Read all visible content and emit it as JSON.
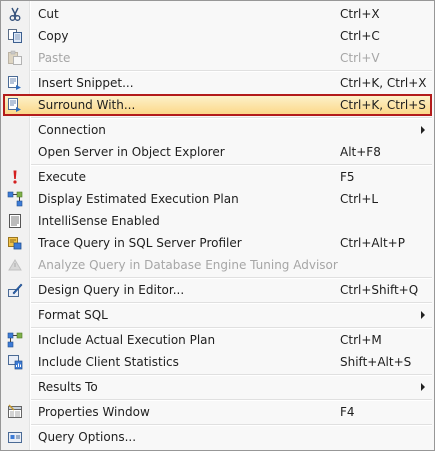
{
  "menu": {
    "items": [
      {
        "id": "cut",
        "label": "Cut",
        "shortcut": "Ctrl+X",
        "icon": "scissors-icon",
        "disabled": false
      },
      {
        "id": "copy",
        "label": "Copy",
        "shortcut": "Ctrl+C",
        "icon": "copy-icon",
        "disabled": false
      },
      {
        "id": "paste",
        "label": "Paste",
        "shortcut": "Ctrl+V",
        "icon": "paste-icon",
        "disabled": true
      },
      {
        "id": "insert-snippet",
        "label": "Insert Snippet...",
        "shortcut": "Ctrl+K, Ctrl+X",
        "icon": "snippet-icon",
        "disabled": false
      },
      {
        "id": "surround-with",
        "label": "Surround With...",
        "shortcut": "Ctrl+K, Ctrl+S",
        "icon": "surround-icon",
        "disabled": false,
        "highlighted": true
      },
      {
        "id": "connection",
        "label": "Connection",
        "shortcut": "",
        "icon": "",
        "submenu": true
      },
      {
        "id": "open-server",
        "label": "Open Server in Object Explorer",
        "shortcut": "Alt+F8",
        "icon": ""
      },
      {
        "id": "execute",
        "label": "Execute",
        "shortcut": "F5",
        "icon": "execute-icon"
      },
      {
        "id": "display-plan",
        "label": "Display Estimated Execution Plan",
        "shortcut": "Ctrl+L",
        "icon": "execution-plan-icon"
      },
      {
        "id": "intellisense",
        "label": "IntelliSense Enabled",
        "shortcut": "",
        "icon": "intellisense-icon"
      },
      {
        "id": "trace-query",
        "label": "Trace Query in SQL Server Profiler",
        "shortcut": "Ctrl+Alt+P",
        "icon": "profiler-icon"
      },
      {
        "id": "analyze-query",
        "label": "Analyze Query in Database Engine Tuning Advisor",
        "shortcut": "",
        "icon": "tuning-advisor-icon",
        "disabled": true
      },
      {
        "id": "design-query",
        "label": "Design Query in Editor...",
        "shortcut": "Ctrl+Shift+Q",
        "icon": "design-query-icon"
      },
      {
        "id": "format-sql",
        "label": "Format SQL",
        "shortcut": "",
        "icon": "",
        "submenu": true
      },
      {
        "id": "include-plan",
        "label": "Include Actual Execution Plan",
        "shortcut": "Ctrl+M",
        "icon": "actual-plan-icon"
      },
      {
        "id": "client-stats",
        "label": "Include Client Statistics",
        "shortcut": "Shift+Alt+S",
        "icon": "client-stats-icon"
      },
      {
        "id": "results-to",
        "label": "Results To",
        "shortcut": "",
        "icon": "",
        "submenu": true
      },
      {
        "id": "properties",
        "label": "Properties Window",
        "shortcut": "F4",
        "icon": "properties-icon"
      },
      {
        "id": "query-options",
        "label": "Query Options...",
        "shortcut": "",
        "icon": "query-options-icon"
      }
    ],
    "colors": {
      "highlight_border": "#b31b1b",
      "highlight_fill_top": "#fdf1c9",
      "highlight_fill_bottom": "#fbd88a",
      "disabled_text": "#a6a6a6",
      "execute_red": "#d42020"
    }
  }
}
